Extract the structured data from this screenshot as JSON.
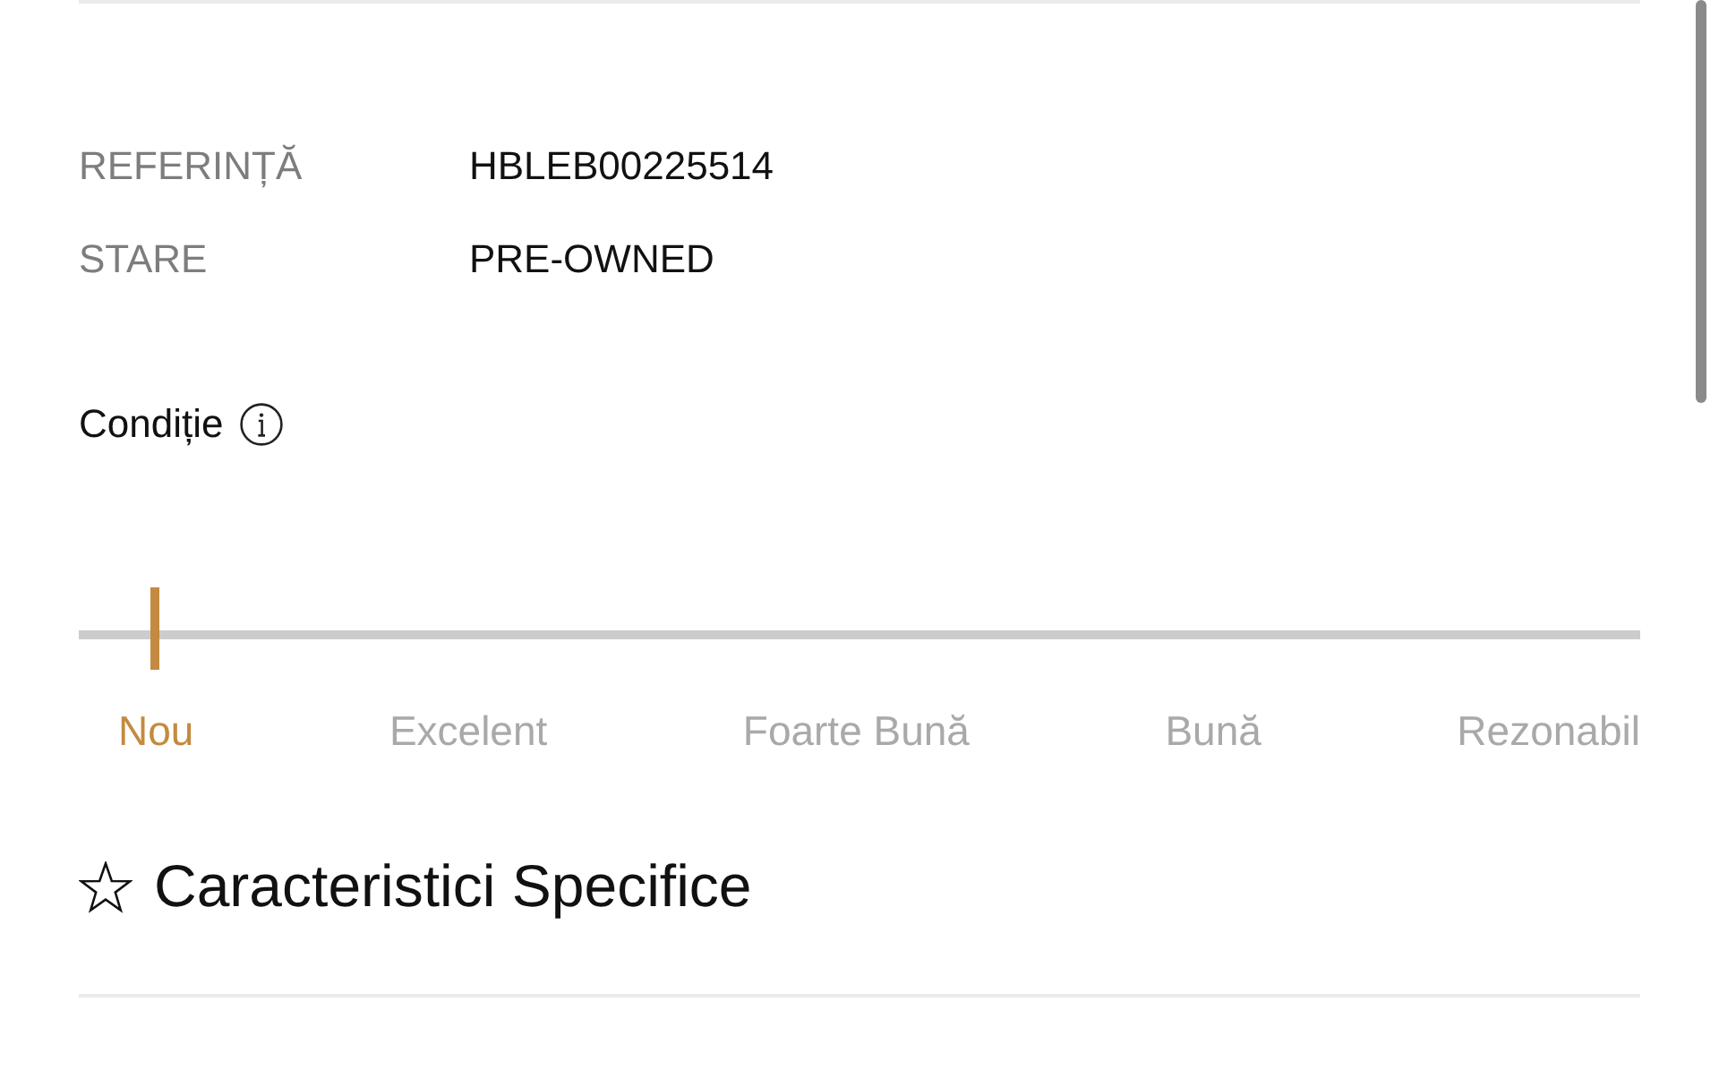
{
  "details": [
    {
      "label": "REFERINȚĂ",
      "value": "HBLEB00225514"
    },
    {
      "label": "STARE",
      "value": "PRE-OWNED"
    }
  ],
  "condition": {
    "title": "Condiție",
    "conditions": [
      {
        "label": "Nou",
        "selected": true
      },
      {
        "label": "Excelent",
        "selected": false
      },
      {
        "label": "Foarte Bună",
        "selected": false
      },
      {
        "label": "Bună",
        "selected": false
      },
      {
        "label": "Rezonabil",
        "selected": false
      }
    ]
  },
  "section": {
    "title": "Caracteristici Specifice"
  }
}
